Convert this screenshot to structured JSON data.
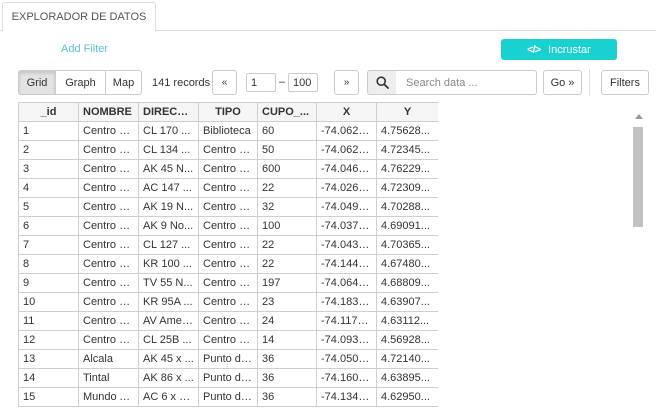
{
  "tab": {
    "label": "EXPLORADOR DE DATOS"
  },
  "toolbar": {
    "add_filter": "Add Filter",
    "embed_icon": "</>",
    "embed_label": "Incrustar",
    "accent": "#1ad1d1"
  },
  "views": {
    "grid": "Grid",
    "graph": "Graph",
    "map": "Map",
    "active": "Grid"
  },
  "pager": {
    "records": "141 records",
    "prev": "«",
    "from": "1",
    "dash": "–",
    "to": "100",
    "next": "»"
  },
  "search": {
    "icon": "search-icon",
    "placeholder": "Search data ...",
    "go": "Go »"
  },
  "filters_label": "Filters",
  "grid": {
    "columns": [
      "_id",
      "NOMBRE",
      "DIRECC...",
      "TIPO",
      "CUPO_...",
      "X",
      "Y"
    ],
    "rows": [
      [
        "1",
        "Centro C...",
        "CL 170 ...",
        "Biblioteca",
        "60",
        "-74.0620...",
        "4.75628..."
      ],
      [
        "2",
        "Centro C...",
        "CL 134 ...",
        "Centro C...",
        "50",
        "-74.0624...",
        "4.72345..."
      ],
      [
        "3",
        "Centro C...",
        "AK 45 N...",
        "Centro C...",
        "600",
        "-74.0463...",
        "4.76229..."
      ],
      [
        "4",
        "Centro C...",
        "AC 147 ...",
        "Centro C...",
        "22",
        "-74.0266...",
        "4.72309..."
      ],
      [
        "5",
        "Centro C...",
        "AK 19 N...",
        "Centro C...",
        "32",
        "-74.0493...",
        "4.70288..."
      ],
      [
        "6",
        "Centro C...",
        "AK 9 No...",
        "Centro C...",
        "100",
        "-74.0370...",
        "4.69091..."
      ],
      [
        "7",
        "Centro C...",
        "CL 127 ...",
        "Centro C...",
        "22",
        "-74.0435...",
        "4.70365..."
      ],
      [
        "8",
        "Centro C...",
        "KR 100 ...",
        "Centro C...",
        "22",
        "-74.1444...",
        "4.67480..."
      ],
      [
        "9",
        "Centro C...",
        "TV 55 N...",
        "Centro C...",
        "197",
        "-74.0642...",
        "4.68809..."
      ],
      [
        "10",
        "Centro C...",
        "KR 95A ...",
        "Centro C...",
        "23",
        "-74.1836...",
        "4.63907..."
      ],
      [
        "11",
        "Centro C...",
        "AV Amer...",
        "Centro C...",
        "24",
        "-74.1174...",
        "4.63112..."
      ],
      [
        "12",
        "Centro C...",
        "CL 25B ...",
        "Centro C...",
        "14",
        "-74.0932...",
        "4.56928..."
      ],
      [
        "13",
        "Alcala",
        "AK 45 x ...",
        "Punto de...",
        "36",
        "-74.0505...",
        "4.72140..."
      ],
      [
        "14",
        "Tintal",
        "AK 86 x ...",
        "Punto de...",
        "36",
        "-74.1605...",
        "4.63895..."
      ],
      [
        "15",
        "Mundo A...",
        "AC 6 x K...",
        "Punto de...",
        "36",
        "-74.1343...",
        "4.62950..."
      ]
    ]
  }
}
